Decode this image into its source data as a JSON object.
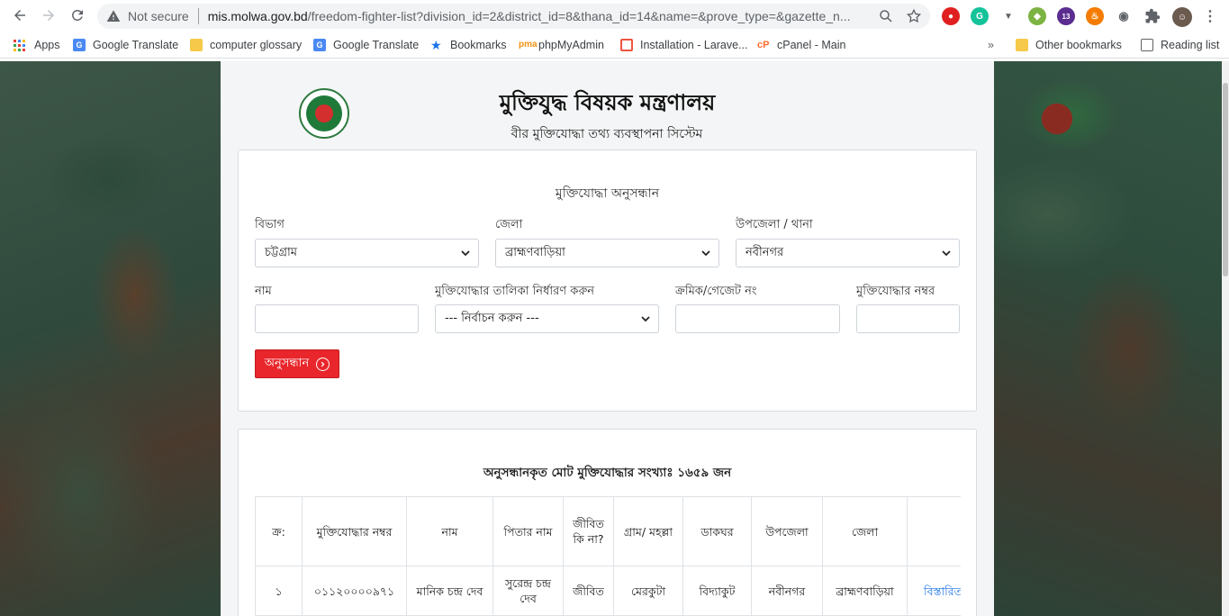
{
  "browser": {
    "not_secure": "Not secure",
    "url_host": "mis.molwa.gov.bd",
    "url_path": "/freedom-fighter-list?division_id=2&district_id=8&thana_id=14&name=&prove_type=&gazette_n...",
    "extension_badge": "13"
  },
  "bookmarks": {
    "apps": "Apps",
    "items": [
      "Google Translate",
      "computer glossary",
      "Google Translate",
      "Bookmarks",
      "phpMyAdmin",
      "Installation - Larave...",
      "cPanel - Main"
    ],
    "overflow": "»",
    "other": "Other bookmarks",
    "reading_list": "Reading list"
  },
  "header": {
    "title": "মুক্তিযুদ্ধ বিষয়ক মন্ত্রণালয়",
    "subtitle": "বীর মুক্তিযোদ্ধা তথ্য ব্যবস্থাপনা সিস্টেম"
  },
  "search": {
    "heading": "মুক্তিযোদ্ধা অনুসন্ধান",
    "division_label": "বিভাগ",
    "division_value": "চট্টগ্রাম",
    "district_label": "জেলা",
    "district_value": "ব্রাহ্মণবাড়িয়া",
    "thana_label": "উপজেলা / থানা",
    "thana_value": "নবীনগর",
    "name_label": "নাম",
    "name_value": "",
    "list_type_label": "মুক্তিযোদ্ধার তালিকা নির্ধারণ করুন",
    "list_type_value": "--- নির্বাচন করুন ---",
    "gazette_label": "ক্রমিক/গেজেট নং",
    "gazette_value": "",
    "ff_number_label": "মুক্তিযোদ্ধার নম্বর",
    "ff_number_value": "",
    "button_label": "অনুসন্ধান"
  },
  "results": {
    "heading": "অনুসন্ধানকৃত মোট মুক্তিযোদ্ধার সংখ্যাঃ ১৬৫৯ জন",
    "columns": [
      "ক্র:",
      "মুক্তিযোদ্ধার নম্বর",
      "নাম",
      "পিতার নাম",
      "জীবিত কি না?",
      "গ্রাম/ মহল্লা",
      "ডাকঘর",
      "উপজেলা",
      "জেলা",
      ""
    ],
    "rows": [
      {
        "serial": "১",
        "ff_number": "০১১২০০০০৯৭১",
        "name": "মানিক চন্দ্র দেব",
        "father": "সুরেন্দ্র চন্দ্র দেব",
        "alive": "জীবিত",
        "village": "মেরকুটা",
        "post_office": "বিদ্যাকুট",
        "upazila": "নবীনগর",
        "district": "ব্রাহ্মণবাড়িয়া",
        "link": "বিস্তারিত"
      }
    ]
  },
  "colors": {
    "primary_button": "#e8262b",
    "link": "#1a73e8"
  }
}
